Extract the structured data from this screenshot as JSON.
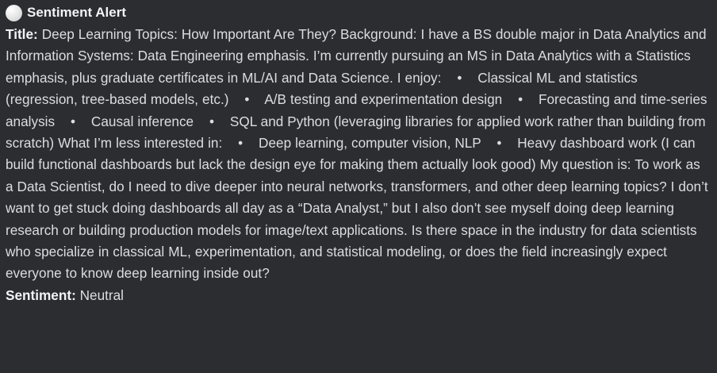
{
  "alert": {
    "icon": "white-circle-icon",
    "title": "Sentiment Alert",
    "post_title_label": "Title:",
    "post_text": "Deep Learning Topics: How Important Are They? Background: I have a BS double major in Data Analytics and Information Systems: Data Engineering emphasis. I’m currently pursuing an MS in Data Analytics with a Statistics emphasis, plus graduate certificates in ML/AI and Data Science. I enjoy:    •    Classical ML and statistics (regression, tree-based models, etc.)    •    A/B testing and experimentation design    •    Forecasting and time-series analysis    •    Causal inference    •    SQL and Python (leveraging libraries for applied work rather than building from scratch) What I’m less interested in:    •    Deep learning, computer vision, NLP    •    Heavy dashboard work (I can build functional dashboards but lack the design eye for making them actually look good) My question is: To work as a Data Scientist, do I need to dive deeper into neural networks, transformers, and other deep learning topics? I don’t want to get stuck doing dashboards all day as a “Data Analyst,” but I also don’t see myself doing deep learning research or building production models for image/text applications. Is there space in the industry for data scientists who specialize in classical ML, experimentation, and statistical modeling, or does the field increasingly expect everyone to know deep learning inside out?",
    "sentiment_label": "Sentiment:",
    "sentiment_value": "Neutral"
  },
  "colors": {
    "background": "#2b2d31",
    "text": "#dbdee1",
    "heading": "#f2f3f5"
  }
}
